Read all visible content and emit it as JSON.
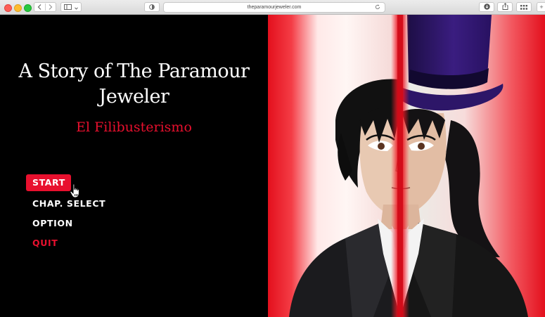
{
  "browser": {
    "url": "theparamourjeweler.com",
    "icons": [
      "back-icon",
      "forward-icon",
      "sidebar-icon",
      "shield-icon",
      "reload-icon",
      "download-icon",
      "share-icon",
      "grid-icon"
    ]
  },
  "game": {
    "title_line1": "A Story of The Paramour",
    "title_line2": "Jeweler",
    "subtitle": "El Filibusterismo",
    "menu": {
      "start": "START",
      "chap_select": "CHAP. SELECT",
      "option": "OPTION",
      "quit": "QUIT"
    }
  },
  "colors": {
    "accent_red": "#e8102e",
    "background": "#000000",
    "text": "#ffffff"
  }
}
